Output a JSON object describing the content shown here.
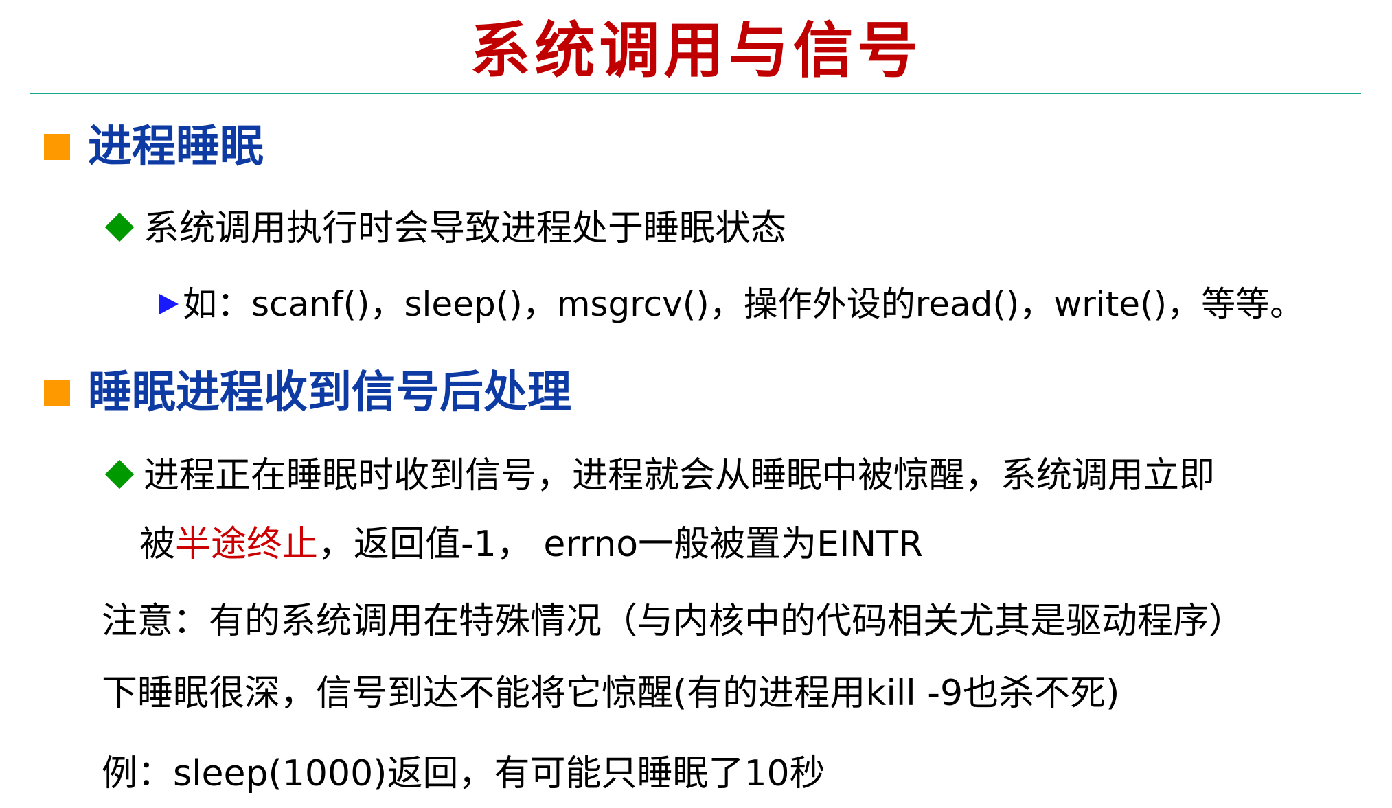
{
  "colors": {
    "title": "#c00000",
    "heading": "#0d3aa3",
    "rule": "#18a78e",
    "square_bullet": "#ff9900",
    "diamond_bullet": "#009900",
    "arrow_bullet": "#1a1aff",
    "emphasis": "#cc0000"
  },
  "title": "系统调用与信号",
  "section1": {
    "heading": "进程睡眠",
    "item": "系统调用执行时会导致进程处于睡眠状态",
    "subitem": "如：scanf()，sleep()，msgrcv()，操作外设的read()，write()，等等。"
  },
  "section2": {
    "heading": "睡眠进程收到信号后处理",
    "item_line1": "进程正在睡眠时收到信号，进程就会从睡眠中被惊醒，系统调用立即",
    "item_line2_pre": "被",
    "item_line2_emph": "半途终止",
    "item_line2_post": "，返回值-1， errno一般被置为EINTR"
  },
  "note": {
    "line1": "注意：有的系统调用在特殊情况（与内核中的代码相关尤其是驱动程序）",
    "line2": "下睡眠很深，信号到达不能将它惊醒(有的进程用kill -9也杀不死)"
  },
  "example": "例：sleep(1000)返回，有可能只睡眠了10秒"
}
